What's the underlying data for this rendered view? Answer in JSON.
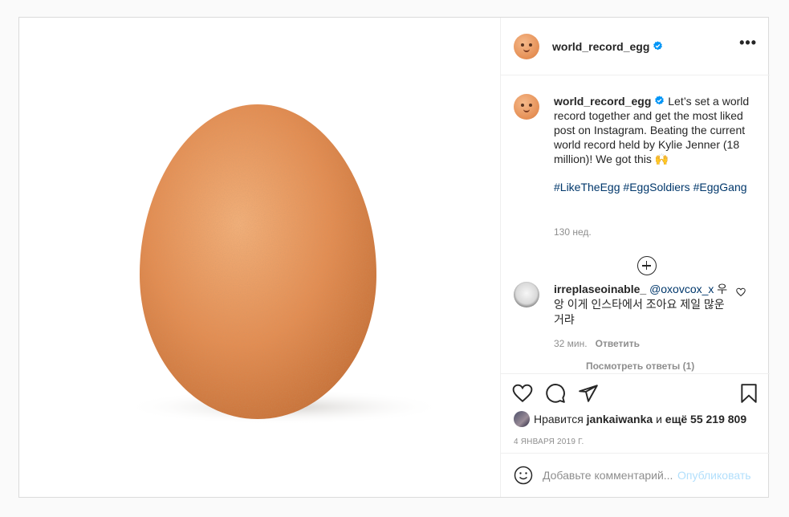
{
  "post": {
    "username": "world_record_egg",
    "verified": true,
    "media_alt": "egg",
    "caption": "Let’s set a world record together and get the most liked post on Instagram. Beating the current world record held by Kylie Jenner (18 million)! We got this 🙌",
    "hashtags": [
      "#LikeTheEgg",
      "#EggSoldiers",
      "#EggGang"
    ],
    "caption_age": "130 нед."
  },
  "comment": {
    "username": "irreplaseoinable_",
    "mention": "@oxovcox_x",
    "text": " 우앙 이게 인스타에서 조아요 제일 많운거랴",
    "age": "32 мин.",
    "reply_label": "Ответить",
    "view_replies": "Посмотреть ответы (1)"
  },
  "likes": {
    "prefix": "Нравится",
    "user": "jankaiwanka",
    "connector": "и",
    "count_text": "ещё 55 219 809"
  },
  "date": "4 ЯНВАРЯ 2019 Г.",
  "add_comment": {
    "placeholder": "Добавьте комментарий...",
    "post_label": "Опубликовать"
  },
  "icons": {
    "more": "more-dots-icon",
    "verified": "verified-badge-icon",
    "expand": "plus-circle-icon",
    "heart": "heart-icon",
    "comment": "comment-icon",
    "share": "share-icon",
    "save": "bookmark-icon",
    "emoji": "emoji-icon"
  },
  "colors": {
    "link": "#00376b",
    "verified": "#0095f6",
    "muted": "#8e8e8e",
    "post_button_disabled": "#b2dffc"
  }
}
